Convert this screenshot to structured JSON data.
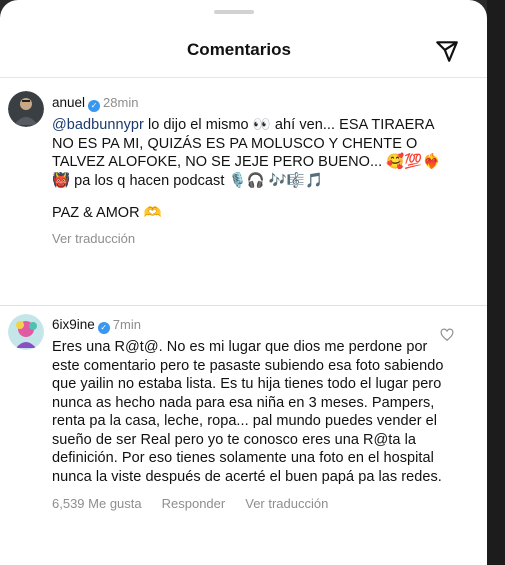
{
  "header": {
    "title": "Comentarios"
  },
  "comments": [
    {
      "username": "anuel",
      "time": "28min",
      "mention": "@badbunnypr",
      "text_after_mention": " lo dijo el mismo 👀 ahí ven... ESA TIRAERA NO ES PA MI, QUIZÁS ES PA MOLUSCO Y CHENTE O TALVEZ ALOFOKE,  NO SE JEJE PERO BUENO... 🥰💯❤️‍🔥👹 pa los q hacen podcast 🎙️🎧 🎶🎼🎵",
      "closing": "PAZ & AMOR 🫶",
      "translate_label": "Ver traducción"
    },
    {
      "username": "6ix9ine",
      "time": "7min",
      "text": "Eres una R@t@. No es mi lugar que dios me perdone por este comentario pero te pasaste subiendo esa foto sabiendo que yailin no estaba lista. Es tu hija tienes todo el lugar pero nunca as hecho nada para esa niña en 3 meses. Pampers, renta pa la casa, leche, ropa... pal mundo puedes vender el sueño de ser Real pero yo te conosco eres una R@ta la definición. Por eso tienes solamente una foto en el hospital nunca la viste después de acerté el buen papá pa las redes.",
      "likes": "6,539 Me gusta",
      "reply_label": "Responder",
      "translate_label": "Ver traducción"
    }
  ],
  "icons": {
    "send": "send-icon",
    "verified": "verified-badge-icon",
    "like": "heart-icon"
  },
  "colors": {
    "verified": "#3897f0",
    "mention": "#1b3b70",
    "muted": "#8e8e8e"
  }
}
